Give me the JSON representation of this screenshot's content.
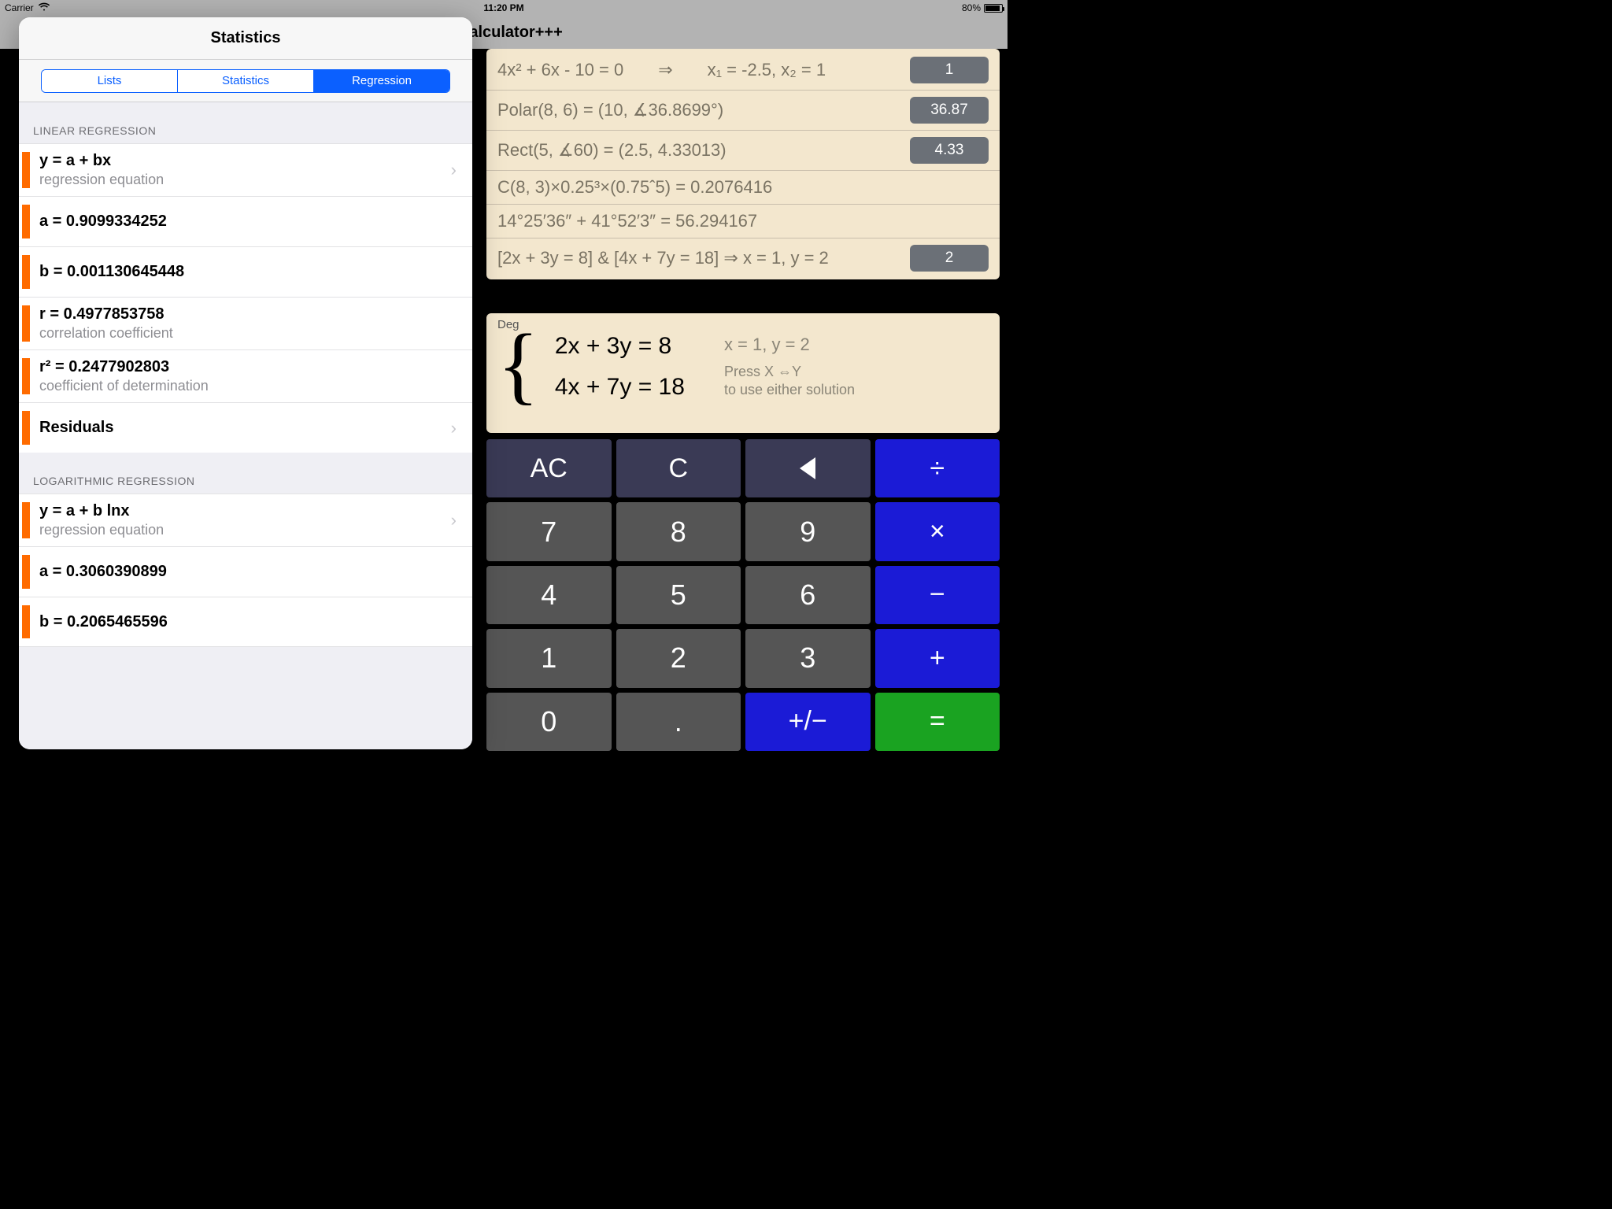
{
  "statusbar": {
    "carrier": "Carrier",
    "time": "11:20 PM",
    "battery": "80%"
  },
  "app": {
    "title_visible": "s Calculator+++"
  },
  "history": {
    "rows": [
      {
        "expr_html": "4x² + 6x - 10 = 0  ⇒  x₁ = -2.5, x₂ = 1",
        "badge": "1"
      },
      {
        "expr_html": "Polar(8, 6) = (10, ∡36.8699°)",
        "badge": "36.87"
      },
      {
        "expr_html": "Rect(5, ∡60) = (2.5, 4.33013)",
        "badge": "4.33"
      },
      {
        "expr_html": "C(8, 3)×0.25³×(0.75ˆ5) = 0.2076416",
        "badge": null
      },
      {
        "expr_html": "14°25′36″ + 41°52′3″ = 56.294167",
        "badge": null
      },
      {
        "expr_html": "[2x + 3y = 8]  &  [4x + 7y = 18] ⇒ x = 1, y = 2",
        "badge": "2"
      }
    ]
  },
  "current": {
    "mode": "Deg",
    "eq1": "2x + 3y = 8",
    "eq2": "4x + 7y = 18",
    "solution": "x = 1, y = 2",
    "hint1": "Press X ⇔Y",
    "hint2": "to use either solution"
  },
  "keypad": {
    "r0": [
      "AC",
      "C",
      "◁",
      "÷"
    ],
    "r1": [
      "7",
      "8",
      "9",
      "×"
    ],
    "r2": [
      "4",
      "5",
      "6",
      "−"
    ],
    "r3": [
      "1",
      "2",
      "3",
      "+"
    ],
    "r4": [
      "0",
      ".",
      "+/−",
      "="
    ]
  },
  "popover": {
    "title": "Statistics",
    "segments": [
      "Lists",
      "Statistics",
      "Regression"
    ],
    "active_segment": 2,
    "linear_header": "LINEAR REGRESSION",
    "log_header": "LOGARITHMIC REGRESSION",
    "linear": [
      {
        "title": "y = a + bx",
        "sub": "regression equation",
        "chevron": true
      },
      {
        "title": "a = 0.9099334252",
        "sub": null,
        "chevron": false
      },
      {
        "title": "b = 0.001130645448",
        "sub": null,
        "chevron": false
      },
      {
        "title": "r = 0.4977853758",
        "sub": "correlation coefficient",
        "chevron": false
      },
      {
        "title": "r² = 0.2477902803",
        "sub": "coefficient of determination",
        "chevron": false
      },
      {
        "title": "Residuals",
        "sub": null,
        "chevron": true
      }
    ],
    "log": [
      {
        "title": "y = a + b lnx",
        "sub": "regression equation",
        "chevron": true
      },
      {
        "title": "a = 0.3060390899",
        "sub": null,
        "chevron": false
      },
      {
        "title": "b = 0.2065465596",
        "sub": null,
        "chevron": false
      }
    ]
  }
}
